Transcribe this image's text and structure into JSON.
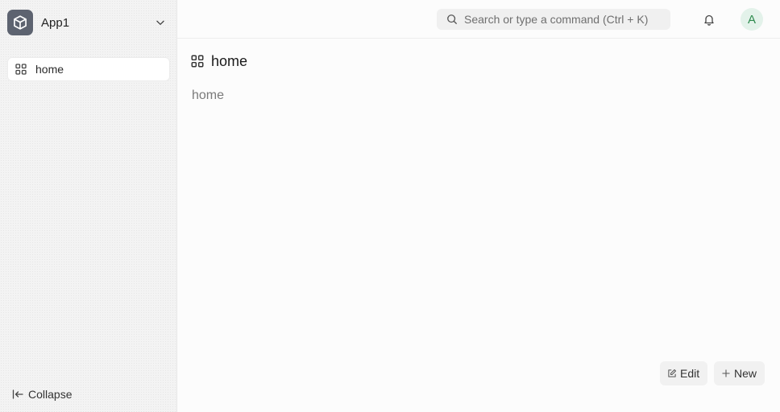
{
  "sidebar": {
    "app_name": "App1",
    "items": [
      {
        "label": "home",
        "icon": "grid-icon"
      }
    ],
    "collapse_label": "Collapse"
  },
  "topbar": {
    "search_placeholder": "Search or type a command (Ctrl + K)",
    "avatar_initial": "A",
    "avatar_color": "#2d8a4e",
    "avatar_bg": "#e3f2ea"
  },
  "page": {
    "title": "home",
    "content": "home"
  },
  "actions": {
    "edit_label": "Edit",
    "new_label": "New"
  }
}
